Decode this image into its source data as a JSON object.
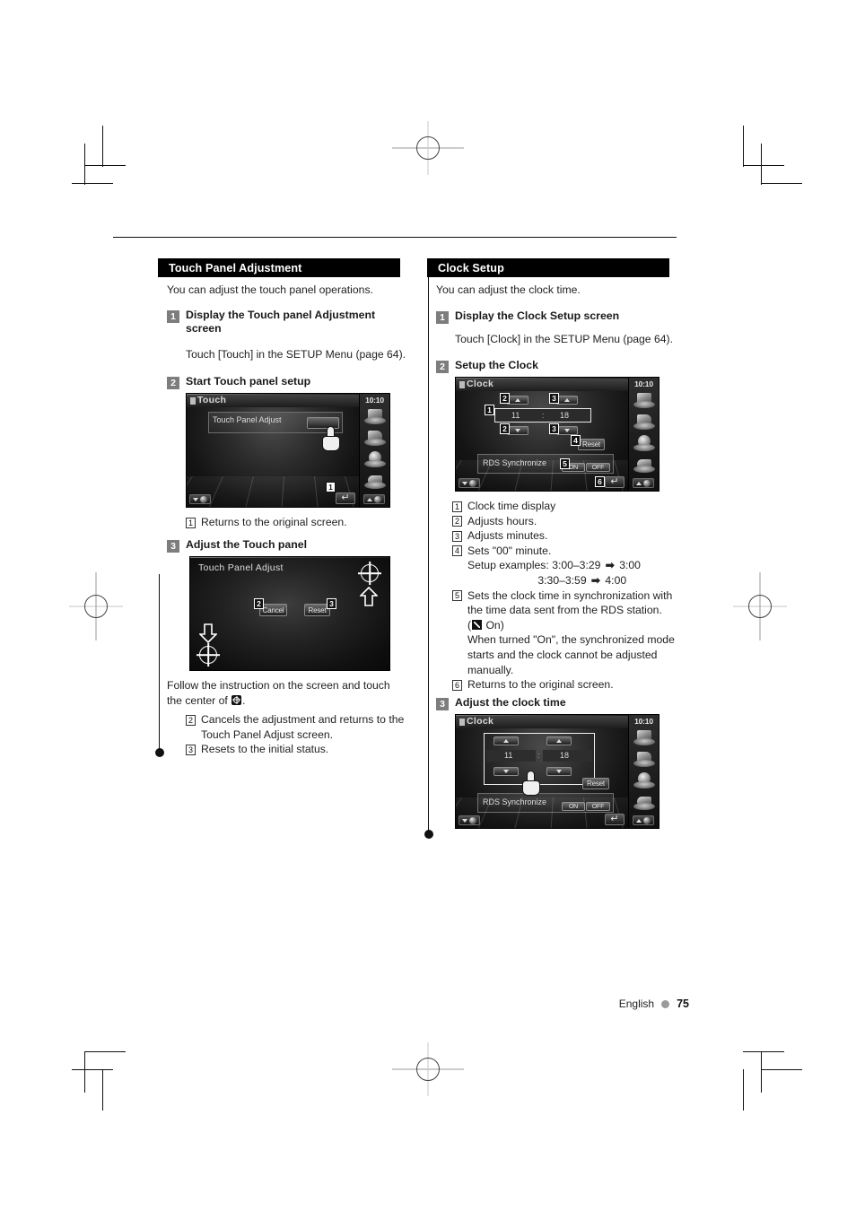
{
  "page": {
    "footer_language": "English",
    "footer_page_number": "75"
  },
  "left_column": {
    "section_title": "Touch Panel Adjustment",
    "intro": "You can adjust the touch panel operations.",
    "steps": [
      {
        "number": "1",
        "title": "Display the Touch panel Adjustment screen",
        "body": "Touch [Touch] in the SETUP Menu (page 64)."
      },
      {
        "number": "2",
        "title": "Start Touch panel setup"
      },
      {
        "number": "3",
        "title": "Adjust the Touch panel"
      }
    ],
    "touch_screen": {
      "title": "Touch",
      "clock": "10:10",
      "panel_label": "Touch Panel Adjust",
      "marker_1": "1"
    },
    "touch_callouts": [
      {
        "num": "1",
        "text": "Returns to the original screen."
      }
    ],
    "adjust_screen": {
      "title": "Touch Panel Adjust",
      "cancel_label": "Cancel",
      "reset_label": "Reset",
      "marker_cancel": "2",
      "marker_reset": "3"
    },
    "instruction_a": "Follow the instruction on the screen and touch",
    "instruction_b": "the center of",
    "adjust_callouts": [
      {
        "num": "2",
        "text": "Cancels the adjustment and returns to the",
        "cont": "Touch Panel Adjust screen."
      },
      {
        "num": "3",
        "text": "Resets to the initial status."
      }
    ]
  },
  "right_column": {
    "section_title": "Clock Setup",
    "intro": "You can adjust the clock time.",
    "steps": [
      {
        "number": "1",
        "title": "Display the Clock Setup screen",
        "body": "Touch [Clock] in the SETUP Menu (page 64)."
      },
      {
        "number": "2",
        "title": "Setup the Clock"
      },
      {
        "number": "3",
        "title": "Adjust the clock time"
      }
    ],
    "clock_screen": {
      "title": "Clock",
      "clock": "10:10",
      "hour_value": "11",
      "separator": ":",
      "minute_value": "18",
      "reset_label": "Reset",
      "rds_label": "RDS Synchronize",
      "rds_on": "ON",
      "rds_off": "OFF",
      "markers": {
        "display": "1",
        "hours_up": "2",
        "hours_down": "2",
        "minutes_up": "3",
        "minutes_down": "3",
        "reset": "4",
        "rds": "5",
        "return": "6"
      }
    },
    "callouts": [
      {
        "num": "1",
        "lines": [
          "Clock time display"
        ]
      },
      {
        "num": "2",
        "lines": [
          "Adjusts hours."
        ]
      },
      {
        "num": "3",
        "lines": [
          "Adjusts minutes."
        ]
      },
      {
        "num": "4",
        "lines": [
          "Sets \"00\" minute."
        ]
      },
      {
        "num": "5",
        "lines": [
          "Sets the clock time in synchronization with",
          "the time data sent from the RDS station."
        ]
      },
      {
        "num": "6",
        "lines": [
          "Returns to the original screen."
        ]
      }
    ],
    "setup_examples_label": "Setup examples:",
    "setup_example_1_from": "3:00–3:29",
    "setup_example_1_to": "3:00",
    "setup_example_2_from": "3:30–3:59",
    "setup_example_2_to": "4:00",
    "arrow_symbol": "➡",
    "rds_on_note": "On)",
    "rds_note_lines": [
      "When turned \"On\", the synchronized mode",
      "starts and the clock cannot be adjusted",
      "manually."
    ],
    "clock_screen_2": {
      "title": "Clock",
      "clock": "10:10",
      "hour_value": "11",
      "separator": ":",
      "minute_value": "18",
      "reset_label": "Reset",
      "rds_label": "RDS Synchronize",
      "rds_on": "ON",
      "rds_off": "OFF"
    }
  }
}
